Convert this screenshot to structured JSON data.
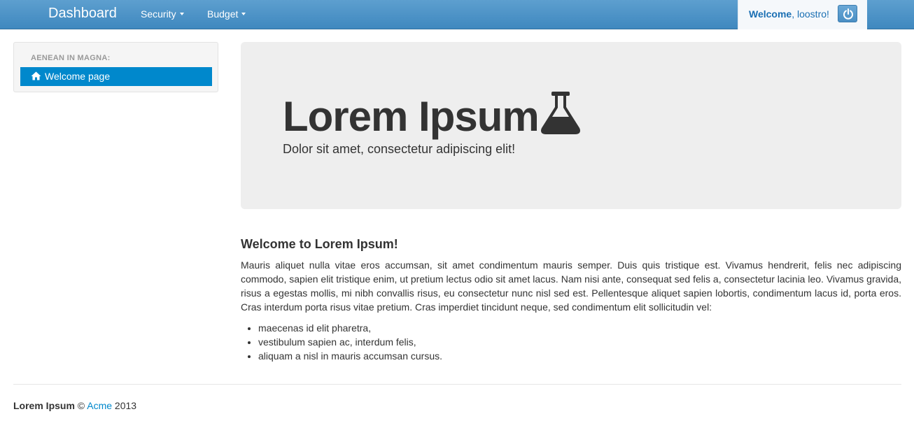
{
  "navbar": {
    "brand": "Dashboard",
    "menus": [
      {
        "label": "Security"
      },
      {
        "label": "Budget"
      }
    ],
    "user": {
      "welcome_bold": "Welcome",
      "welcome_rest": ", loostro!"
    },
    "icons": {
      "power": "power-icon"
    }
  },
  "sidebar": {
    "header": "AENEAN IN MAGNA:",
    "items": [
      {
        "label": "Welcome page",
        "icon": "home-icon",
        "active": true
      }
    ]
  },
  "hero": {
    "title": "Lorem Ipsum",
    "icon": "flask-icon",
    "subtitle": "Dolor sit amet, consectetur adipiscing elit!"
  },
  "content": {
    "title": "Welcome to Lorem Ipsum!",
    "paragraph": "Mauris aliquet nulla vitae eros accumsan, sit amet condimentum mauris semper. Duis quis tristique est. Vivamus hendrerit, felis nec adipiscing commodo, sapien elit tristique enim, ut pretium lectus odio sit amet lacus. Nam nisi ante, consequat sed felis a, consectetur lacinia leo. Vivamus gravida, risus a egestas mollis, mi nibh convallis risus, eu consectetur nunc nisl sed est. Pellentesque aliquet sapien lobortis, condimentum lacus id, porta eros. Cras interdum porta risus vitae pretium. Cras imperdiet tincidunt neque, sed condimentum elit sollicitudin vel:",
    "list": [
      "maecenas id elit pharetra,",
      "vestibulum sapien ac, interdum felis,",
      "aliquam a nisl in mauris accumsan cursus."
    ]
  },
  "footer": {
    "name": "Lorem Ipsum",
    "copyright": " © ",
    "company": "Acme",
    "year": " 2013"
  },
  "colors": {
    "navbar": "#4a92c8",
    "accent": "#0088cc",
    "hero_bg": "#eeeeee"
  }
}
